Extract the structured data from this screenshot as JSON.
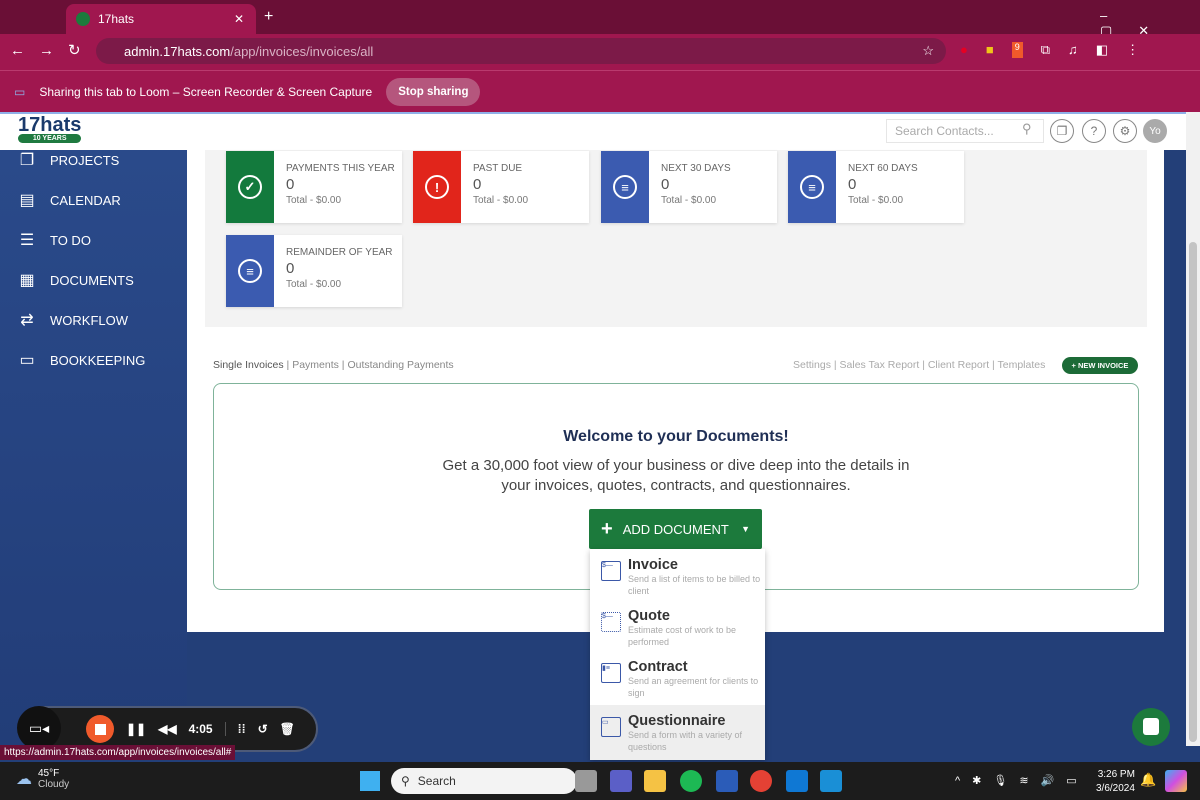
{
  "browser": {
    "tab_title": "17hats",
    "url_host": "admin.17hats.com",
    "url_path": "/app/invoices/invoices/all",
    "status_url": "https://admin.17hats.com/app/invoices/invoices/all#",
    "ext_badge": "9"
  },
  "share_bar": {
    "message": "Sharing this tab to Loom – Screen Recorder & Screen Capture",
    "stop_label": "Stop sharing"
  },
  "header": {
    "logo": "17hats",
    "logo_ribbon": "10 YEARS",
    "search_placeholder": "Search Contacts...",
    "avatar": "Yo"
  },
  "sidebar": {
    "items": [
      {
        "label": "PROJECTS",
        "icon": "projects-icon",
        "glyph": "❐"
      },
      {
        "label": "CALENDAR",
        "icon": "calendar-icon",
        "glyph": "▤"
      },
      {
        "label": "TO DO",
        "icon": "list-icon",
        "glyph": "☰"
      },
      {
        "label": "DOCUMENTS",
        "icon": "documents-icon",
        "glyph": "▦"
      },
      {
        "label": "WORKFLOW",
        "icon": "workflow-icon",
        "glyph": "⇄"
      },
      {
        "label": "BOOKKEEPING",
        "icon": "card-icon",
        "glyph": "▭"
      }
    ]
  },
  "stats": [
    {
      "title": "PAYMENTS THIS YEAR",
      "count": "0",
      "total": "Total - $0.00",
      "color": "#137a3d",
      "glyph": "✓"
    },
    {
      "title": "PAST DUE",
      "count": "0",
      "total": "Total - $0.00",
      "color": "#e1251b",
      "glyph": "!"
    },
    {
      "title": "NEXT 30 DAYS",
      "count": "0",
      "total": "Total - $0.00",
      "color": "#3b5bb0",
      "glyph": "≡"
    },
    {
      "title": "NEXT 60 DAYS",
      "count": "0",
      "total": "Total - $0.00",
      "color": "#3b5bb0",
      "glyph": "≡"
    },
    {
      "title": "REMAINDER OF YEAR",
      "count": "0",
      "total": "Total - $0.00",
      "color": "#3b5bb0",
      "glyph": "≡"
    }
  ],
  "subnav": {
    "left": [
      "Single Invoices",
      "Payments",
      "Outstanding Payments"
    ],
    "right": [
      "Settings",
      "Sales Tax Report",
      "Client Report",
      "Templates"
    ],
    "new_invoice": "+ NEW INVOICE"
  },
  "welcome": {
    "title": "Welcome to your Documents!",
    "text": "Get a 30,000 foot view of your business or dive deep into the details in your invoices, quotes, contracts, and questionnaires.",
    "add_button": "ADD DOCUMENT"
  },
  "menu": [
    {
      "title": "Invoice",
      "desc": "Send a list of items to be billed to client"
    },
    {
      "title": "Quote",
      "desc": "Estimate cost of work to be performed"
    },
    {
      "title": "Contract",
      "desc": "Send an agreement for clients to sign"
    },
    {
      "title": "Questionnaire",
      "desc": "Send a form with a variety of questions"
    }
  ],
  "loom": {
    "timer": "4:05"
  },
  "taskbar": {
    "temp": "45°F",
    "weather": "Cloudy",
    "search": "Search",
    "time": "3:26 PM",
    "date": "3/6/2024"
  }
}
